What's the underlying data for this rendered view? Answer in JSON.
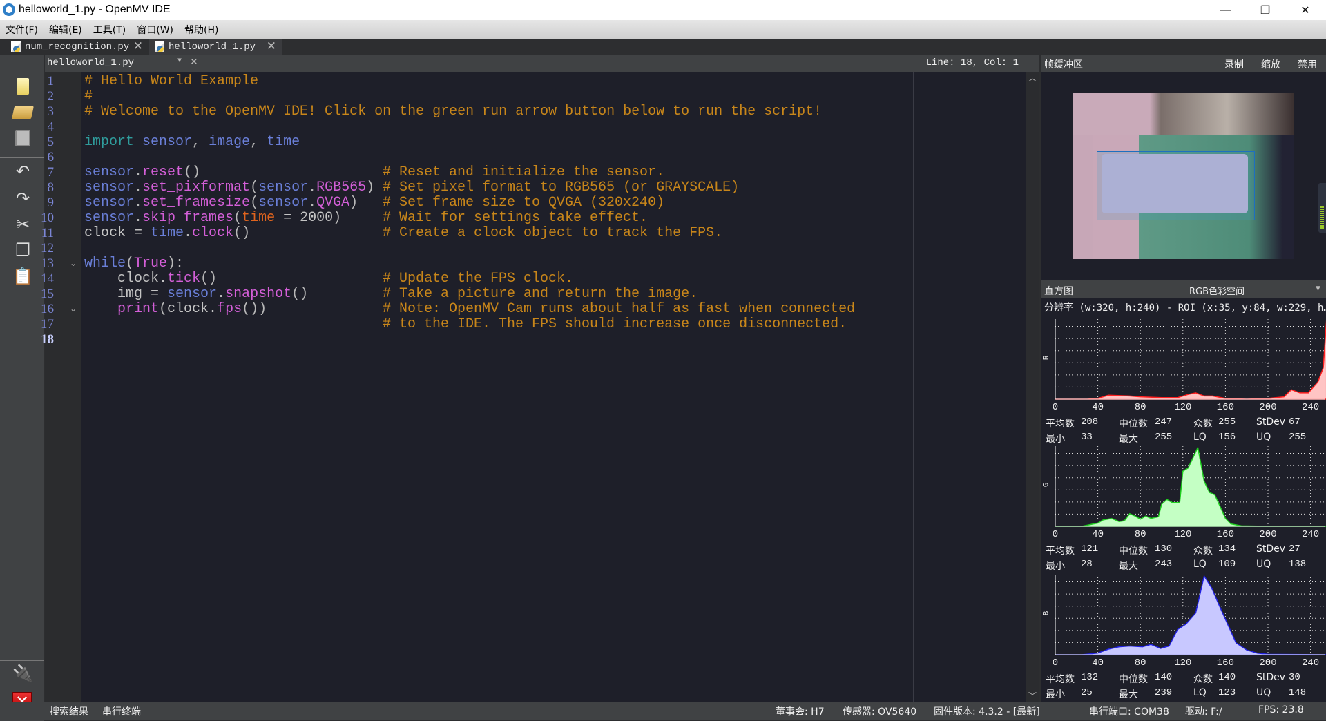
{
  "window": {
    "title": "helloworld_1.py - OpenMV IDE"
  },
  "menu": [
    "文件(F)",
    "编辑(E)",
    "工具(T)",
    "窗口(W)",
    "帮助(H)"
  ],
  "file_tabs": [
    {
      "label": "num_recognition.py",
      "active": false
    },
    {
      "label": "helloworld_1.py",
      "active": true
    }
  ],
  "editor": {
    "file_selector": "helloworld_1.py",
    "cursor": "Line: 18, Col: 1",
    "current_line": 18,
    "folds": [
      13,
      16
    ],
    "lines": [
      {
        "t": [
          [
            "c",
            "# Hello World Example"
          ]
        ]
      },
      {
        "t": [
          [
            "c",
            "#"
          ]
        ]
      },
      {
        "t": [
          [
            "c",
            "# Welcome to the OpenMV IDE! Click on the green run arrow button below to run the script!"
          ]
        ]
      },
      {
        "t": []
      },
      {
        "t": [
          [
            "k",
            "import"
          ],
          [
            "d",
            " "
          ],
          [
            "m",
            "sensor"
          ],
          [
            "p",
            ", "
          ],
          [
            "m",
            "image"
          ],
          [
            "p",
            ", "
          ],
          [
            "m",
            "time"
          ]
        ]
      },
      {
        "t": []
      },
      {
        "t": [
          [
            "m",
            "sensor"
          ],
          [
            "p",
            "."
          ],
          [
            "f",
            "reset"
          ],
          [
            "p",
            "()"
          ]
        ],
        "c": "# Reset and initialize the sensor."
      },
      {
        "t": [
          [
            "m",
            "sensor"
          ],
          [
            "p",
            "."
          ],
          [
            "f",
            "set_pixformat"
          ],
          [
            "p",
            "("
          ],
          [
            "m",
            "sensor"
          ],
          [
            "p",
            "."
          ],
          [
            "f",
            "RGB565"
          ],
          [
            "p",
            ")"
          ]
        ],
        "c": "# Set pixel format to RGB565 (or GRAYSCALE)"
      },
      {
        "t": [
          [
            "m",
            "sensor"
          ],
          [
            "p",
            "."
          ],
          [
            "f",
            "set_framesize"
          ],
          [
            "p",
            "("
          ],
          [
            "m",
            "sensor"
          ],
          [
            "p",
            "."
          ],
          [
            "f",
            "QVGA"
          ],
          [
            "p",
            ")"
          ]
        ],
        "c": "# Set frame size to QVGA (320x240)"
      },
      {
        "t": [
          [
            "m",
            "sensor"
          ],
          [
            "p",
            "."
          ],
          [
            "f",
            "skip_frames"
          ],
          [
            "p",
            "("
          ],
          [
            "a",
            "time"
          ],
          [
            "d",
            " = 2000"
          ],
          [
            "p",
            ")"
          ]
        ],
        "c": "# Wait for settings take effect."
      },
      {
        "t": [
          [
            "d",
            "clock = "
          ],
          [
            "m",
            "time"
          ],
          [
            "p",
            "."
          ],
          [
            "f",
            "clock"
          ],
          [
            "p",
            "()"
          ]
        ],
        "c": "# Create a clock object to track the FPS."
      },
      {
        "t": []
      },
      {
        "t": [
          [
            "m",
            "while"
          ],
          [
            "p",
            "("
          ],
          [
            "f",
            "True"
          ],
          [
            "p",
            "):"
          ]
        ]
      },
      {
        "t": [
          [
            "d",
            "    clock."
          ],
          [
            "f",
            "tick"
          ],
          [
            "p",
            "()"
          ]
        ],
        "c": "# Update the FPS clock."
      },
      {
        "t": [
          [
            "d",
            "    img = "
          ],
          [
            "m",
            "sensor"
          ],
          [
            "p",
            "."
          ],
          [
            "f",
            "snapshot"
          ],
          [
            "p",
            "()"
          ]
        ],
        "c": "# Take a picture and return the image."
      },
      {
        "t": [
          [
            "d",
            "    "
          ],
          [
            "f",
            "print"
          ],
          [
            "p",
            "("
          ],
          [
            "d",
            "clock."
          ],
          [
            "f",
            "fps"
          ],
          [
            "p",
            "())"
          ]
        ],
        "c": "# Note: OpenMV Cam runs about half as fast when connected"
      },
      {
        "t": [],
        "c": "# to the IDE. The FPS should increase once disconnected."
      },
      {
        "t": []
      }
    ]
  },
  "framebuffer": {
    "title": "帧缓冲区",
    "record": "录制",
    "zoom": "缩放",
    "disable": "禁用"
  },
  "histogram": {
    "title": "直方图",
    "colorspace": "RGB色彩空间",
    "resolution": "分辨率 (w:320, h:240) - ROI (x:35, y:84, w:229, h…",
    "ticks": [
      "0",
      "40",
      "80",
      "120",
      "160",
      "200",
      "240"
    ],
    "labels": {
      "mean": "平均数",
      "median": "中位数",
      "mode": "众数",
      "stdev": "StDev",
      "min": "最小",
      "max": "最大",
      "lq": "LQ",
      "uq": "UQ"
    },
    "channels": [
      {
        "name": "R",
        "color": "#ff2020",
        "fill": "#ffc4c4",
        "stats": {
          "mean": "208",
          "median": "247",
          "mode": "255",
          "stdev": "67",
          "min": "33",
          "max": "255",
          "lq": "156",
          "uq": "255"
        },
        "points": [
          [
            0,
            0
          ],
          [
            30,
            0
          ],
          [
            40,
            0.01
          ],
          [
            50,
            0.05
          ],
          [
            70,
            0.04
          ],
          [
            80,
            0.03
          ],
          [
            100,
            0.02
          ],
          [
            115,
            0.02
          ],
          [
            125,
            0.06
          ],
          [
            132,
            0.08
          ],
          [
            140,
            0.04
          ],
          [
            148,
            0.04
          ],
          [
            160,
            0.01
          ],
          [
            180,
            0
          ],
          [
            200,
            0.01
          ],
          [
            215,
            0.03
          ],
          [
            222,
            0.12
          ],
          [
            230,
            0.08
          ],
          [
            238,
            0.08
          ],
          [
            247,
            0.22
          ],
          [
            252,
            0.4
          ],
          [
            255,
            1
          ]
        ]
      },
      {
        "name": "G",
        "color": "#20d020",
        "fill": "#c4ffc4",
        "stats": {
          "mean": "121",
          "median": "130",
          "mode": "134",
          "stdev": "27",
          "min": "28",
          "max": "243",
          "lq": "109",
          "uq": "138"
        },
        "points": [
          [
            0,
            0
          ],
          [
            25,
            0
          ],
          [
            40,
            0.04
          ],
          [
            45,
            0.08
          ],
          [
            53,
            0.1
          ],
          [
            60,
            0.06
          ],
          [
            65,
            0.07
          ],
          [
            70,
            0.16
          ],
          [
            75,
            0.13
          ],
          [
            80,
            0.09
          ],
          [
            85,
            0.13
          ],
          [
            90,
            0.1
          ],
          [
            97,
            0.12
          ],
          [
            100,
            0.28
          ],
          [
            105,
            0.34
          ],
          [
            110,
            0.3
          ],
          [
            117,
            0.3
          ],
          [
            120,
            0.7
          ],
          [
            125,
            0.74
          ],
          [
            134,
            1
          ],
          [
            140,
            0.57
          ],
          [
            145,
            0.43
          ],
          [
            150,
            0.4
          ],
          [
            160,
            0.1
          ],
          [
            165,
            0.03
          ],
          [
            175,
            0.005
          ],
          [
            200,
            0
          ],
          [
            255,
            0
          ]
        ]
      },
      {
        "name": "B",
        "color": "#2020e0",
        "fill": "#c8c8ff",
        "stats": {
          "mean": "132",
          "median": "140",
          "mode": "140",
          "stdev": "30",
          "min": "25",
          "max": "239",
          "lq": "123",
          "uq": "148"
        },
        "points": [
          [
            0,
            0
          ],
          [
            25,
            0
          ],
          [
            40,
            0.02
          ],
          [
            50,
            0.07
          ],
          [
            60,
            0.1
          ],
          [
            70,
            0.11
          ],
          [
            82,
            0.1
          ],
          [
            90,
            0.13
          ],
          [
            99,
            0.08
          ],
          [
            107,
            0.11
          ],
          [
            115,
            0.32
          ],
          [
            123,
            0.39
          ],
          [
            132,
            0.53
          ],
          [
            140,
            1
          ],
          [
            147,
            0.85
          ],
          [
            155,
            0.6
          ],
          [
            170,
            0.15
          ],
          [
            180,
            0.06
          ],
          [
            190,
            0.02
          ],
          [
            200,
            0.005
          ],
          [
            255,
            0
          ]
        ]
      }
    ]
  },
  "bottom_tabs": [
    "搜索结果",
    "串行终端"
  ],
  "status": {
    "board": "董事会: H7",
    "sensor": "传感器: OV5640",
    "firmware": "固件版本: 4.3.2 - [最新]",
    "port": "串行端口: COM38",
    "drive": "驱动: F:/",
    "fps": "FPS: 23.8"
  }
}
